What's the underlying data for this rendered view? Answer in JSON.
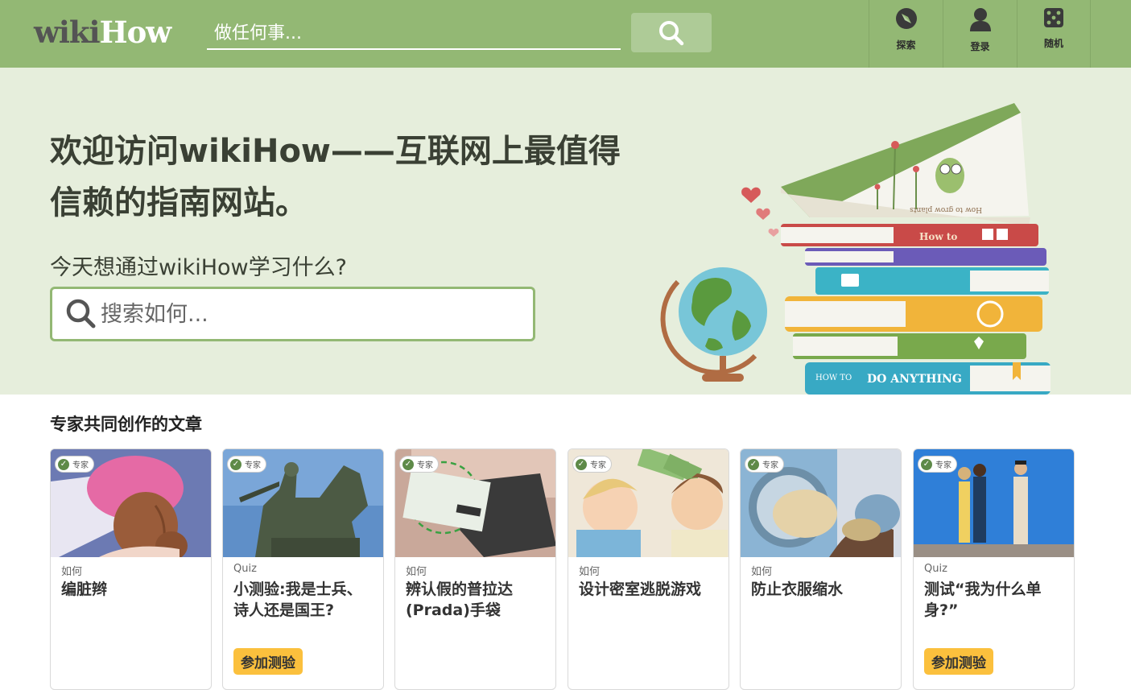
{
  "header": {
    "logo_wiki": "wiki",
    "logo_how": "How",
    "search_placeholder": "做任何事...",
    "nav": [
      {
        "label": "探索",
        "icon": "compass-icon"
      },
      {
        "label": "登录",
        "icon": "user-icon"
      },
      {
        "label": "随机",
        "icon": "dice-icon"
      }
    ]
  },
  "hero": {
    "title": "欢迎访问wikiHow——互联网上最值得信赖的指南网站。",
    "subtitle": "今天想通过wikiHow学习什么?",
    "search_placeholder": "搜索如何...",
    "art": {
      "book_spine_1": "How to",
      "book_spine_2": "DO ANYTHING",
      "book_spine_3": "HOW TO",
      "book_page": "How to grow plants"
    }
  },
  "section": {
    "title": "专家共同创作的文章",
    "badge_label": "专家",
    "cards": [
      {
        "kind": "如何",
        "title": "编脏辫",
        "button": ""
      },
      {
        "kind": "Quiz",
        "title": "小测验:我是士兵、诗人还是国王?",
        "button": "参加测验"
      },
      {
        "kind": "如何",
        "title": "辨认假的普拉达(Prada)手袋",
        "button": ""
      },
      {
        "kind": "如何",
        "title": "设计密室逃脱游戏",
        "button": ""
      },
      {
        "kind": "如何",
        "title": "防止衣服缩水",
        "button": ""
      },
      {
        "kind": "Quiz",
        "title": "测试“我为什么单身?”",
        "button": "参加测验"
      }
    ]
  },
  "colors": {
    "header_green": "#93b874",
    "hero_bg": "#e6eedc",
    "quiz_button": "#fbc03d"
  }
}
